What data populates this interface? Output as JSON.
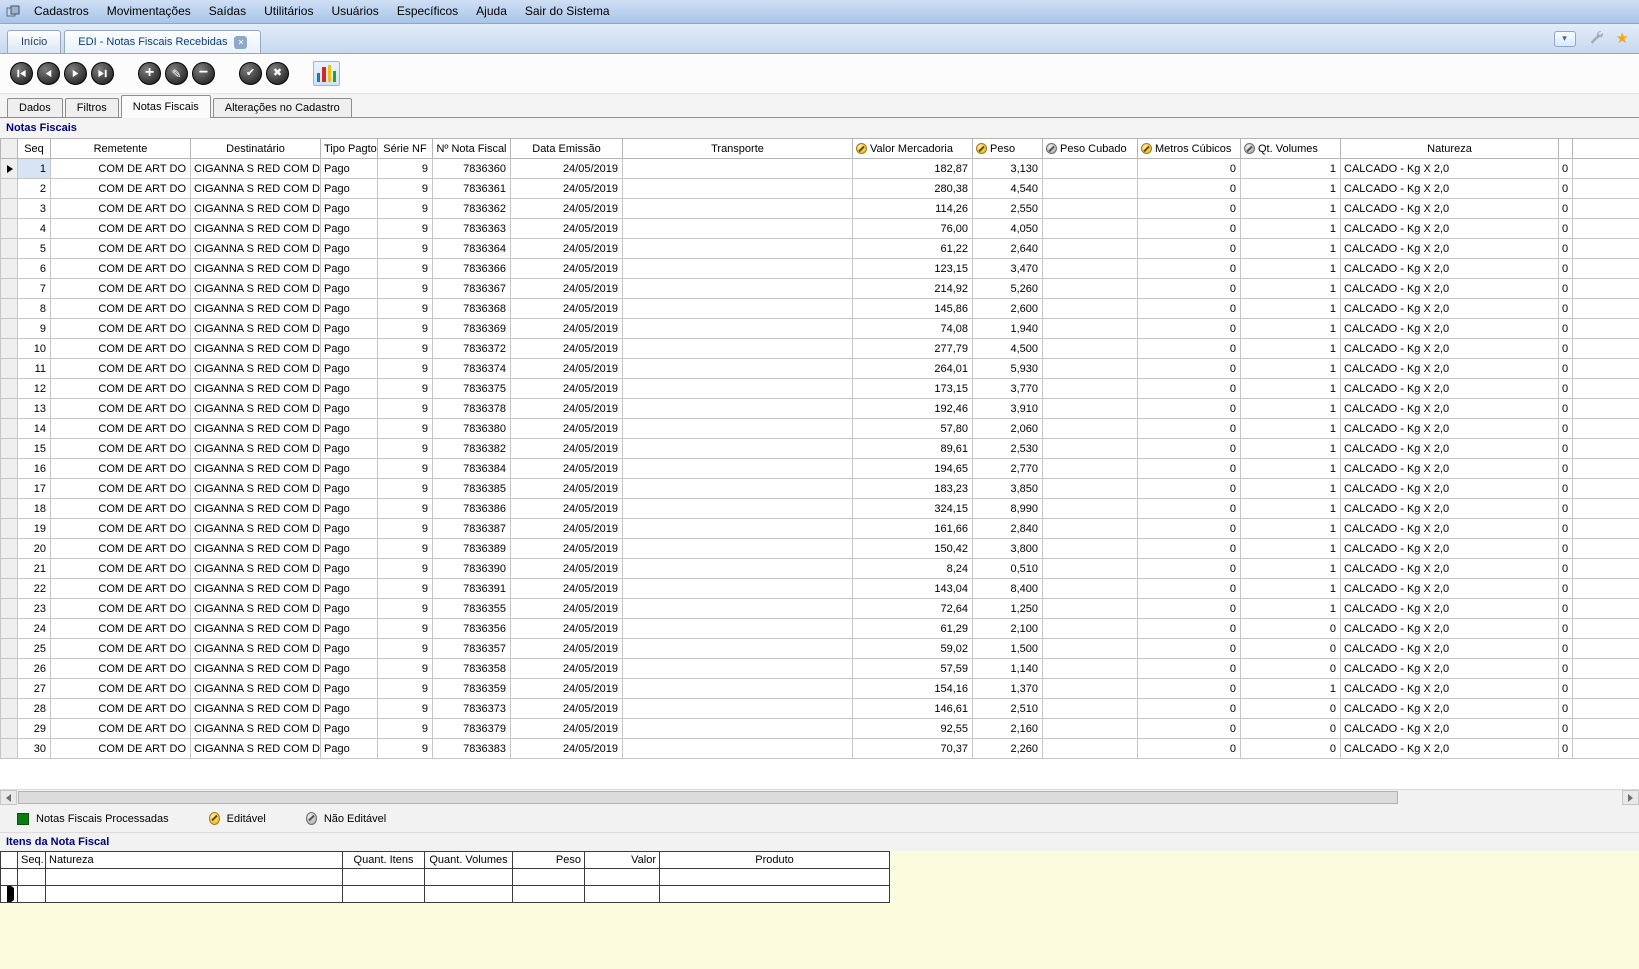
{
  "menu": {
    "items": [
      "Cadastros",
      "Movimentações",
      "Saídas",
      "Utilitários",
      "Usuários",
      "Específicos",
      "Ajuda",
      "Sair do Sistema"
    ]
  },
  "tabs": [
    {
      "label": "Início"
    },
    {
      "label": "EDI - Notas Fiscais Recebidas",
      "active": true,
      "closable": true
    }
  ],
  "subtabs": [
    {
      "label": "Dados"
    },
    {
      "label": "Filtros"
    },
    {
      "label": "Notas Fiscais",
      "active": true
    },
    {
      "label": "Alterações no Cadastro"
    }
  ],
  "section": {
    "title": "Notas Fiscais"
  },
  "grid": {
    "columns": {
      "seq": "Seq",
      "remetente": "Remetente",
      "destinatario": "Destinatário",
      "tipo": "Tipo Pagto",
      "serie": "Série NF",
      "nf": "Nº Nota Fiscal",
      "data": "Data Emissão",
      "transporte": "Transporte",
      "valor": "Valor Mercadoria",
      "peso": "Peso",
      "peso_cubado": "Peso Cubado",
      "metros": "Metros Cúbicos",
      "qt": "Qt. Volumes",
      "natureza": "Natureza"
    },
    "row_defaults": {
      "remetente": "COM DE ART DO",
      "destinatario": "CIGANNA S RED COM DE",
      "tipo": "Pago",
      "serie": "9",
      "data": "24/05/2019",
      "transporte": "",
      "peso_cubado": "",
      "metros": "0",
      "natureza": "CALCADO - Kg X 2,0",
      "extra": "0"
    },
    "rows": [
      {
        "seq": "1",
        "nf": "7836360",
        "valor": "182,87",
        "peso": "3,130",
        "qt": "1",
        "selected": true
      },
      {
        "seq": "2",
        "nf": "7836361",
        "valor": "280,38",
        "peso": "4,540",
        "qt": "1"
      },
      {
        "seq": "3",
        "nf": "7836362",
        "valor": "114,26",
        "peso": "2,550",
        "qt": "1"
      },
      {
        "seq": "4",
        "nf": "7836363",
        "valor": "76,00",
        "peso": "4,050",
        "qt": "1"
      },
      {
        "seq": "5",
        "nf": "7836364",
        "valor": "61,22",
        "peso": "2,640",
        "qt": "1"
      },
      {
        "seq": "6",
        "nf": "7836366",
        "valor": "123,15",
        "peso": "3,470",
        "qt": "1"
      },
      {
        "seq": "7",
        "nf": "7836367",
        "valor": "214,92",
        "peso": "5,260",
        "qt": "1"
      },
      {
        "seq": "8",
        "nf": "7836368",
        "valor": "145,86",
        "peso": "2,600",
        "qt": "1"
      },
      {
        "seq": "9",
        "nf": "7836369",
        "valor": "74,08",
        "peso": "1,940",
        "qt": "1"
      },
      {
        "seq": "10",
        "nf": "7836372",
        "valor": "277,79",
        "peso": "4,500",
        "qt": "1"
      },
      {
        "seq": "11",
        "nf": "7836374",
        "valor": "264,01",
        "peso": "5,930",
        "qt": "1"
      },
      {
        "seq": "12",
        "nf": "7836375",
        "valor": "173,15",
        "peso": "3,770",
        "qt": "1"
      },
      {
        "seq": "13",
        "nf": "7836378",
        "valor": "192,46",
        "peso": "3,910",
        "qt": "1"
      },
      {
        "seq": "14",
        "nf": "7836380",
        "valor": "57,80",
        "peso": "2,060",
        "qt": "1"
      },
      {
        "seq": "15",
        "nf": "7836382",
        "valor": "89,61",
        "peso": "2,530",
        "qt": "1"
      },
      {
        "seq": "16",
        "nf": "7836384",
        "valor": "194,65",
        "peso": "2,770",
        "qt": "1"
      },
      {
        "seq": "17",
        "nf": "7836385",
        "valor": "183,23",
        "peso": "3,850",
        "qt": "1"
      },
      {
        "seq": "18",
        "nf": "7836386",
        "valor": "324,15",
        "peso": "8,990",
        "qt": "1"
      },
      {
        "seq": "19",
        "nf": "7836387",
        "valor": "161,66",
        "peso": "2,840",
        "qt": "1"
      },
      {
        "seq": "20",
        "nf": "7836389",
        "valor": "150,42",
        "peso": "3,800",
        "qt": "1"
      },
      {
        "seq": "21",
        "nf": "7836390",
        "valor": "8,24",
        "peso": "0,510",
        "qt": "1"
      },
      {
        "seq": "22",
        "nf": "7836391",
        "valor": "143,04",
        "peso": "8,400",
        "qt": "1"
      },
      {
        "seq": "23",
        "nf": "7836355",
        "valor": "72,64",
        "peso": "1,250",
        "qt": "1"
      },
      {
        "seq": "24",
        "nf": "7836356",
        "valor": "61,29",
        "peso": "2,100",
        "qt": "0"
      },
      {
        "seq": "25",
        "nf": "7836357",
        "valor": "59,02",
        "peso": "1,500",
        "qt": "0"
      },
      {
        "seq": "26",
        "nf": "7836358",
        "valor": "57,59",
        "peso": "1,140",
        "qt": "0"
      },
      {
        "seq": "27",
        "nf": "7836359",
        "valor": "154,16",
        "peso": "1,370",
        "qt": "1"
      },
      {
        "seq": "28",
        "nf": "7836373",
        "valor": "146,61",
        "peso": "2,510",
        "qt": "0"
      },
      {
        "seq": "29",
        "nf": "7836379",
        "valor": "92,55",
        "peso": "2,160",
        "qt": "0"
      },
      {
        "seq": "30",
        "nf": "7836383",
        "valor": "70,37",
        "peso": "2,260",
        "qt": "0"
      }
    ]
  },
  "legend": {
    "processed": "Notas Fiscais Processadas",
    "editable": "Editável",
    "not_editable": "Não Editável"
  },
  "items_section": {
    "title": "Itens da Nota Fiscal",
    "columns": {
      "seq": "Seq.",
      "natureza": "Natureza",
      "quant_itens": "Quant. Itens",
      "quant_volumes": "Quant. Volumes",
      "peso": "Peso",
      "valor": "Valor",
      "produto": "Produto"
    }
  },
  "colors": {
    "accent_navy": "#000080",
    "editable_coin": "#F0B400",
    "locked_coin": "#A5A5A5",
    "processed_green": "#0B7C10"
  }
}
